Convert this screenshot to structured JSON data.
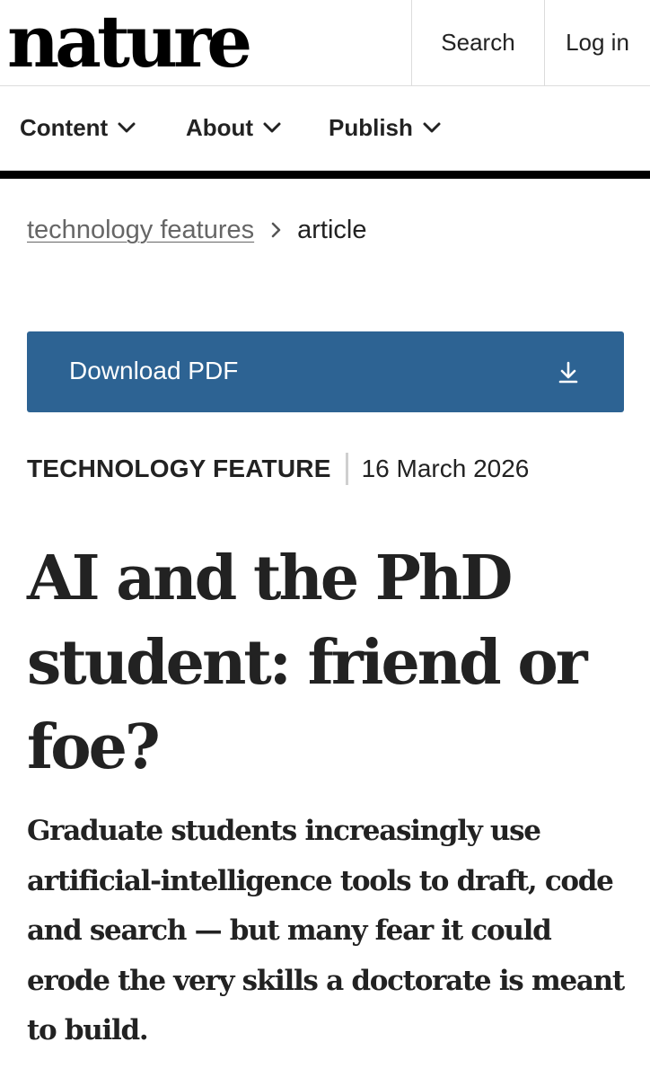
{
  "header": {
    "logo_text": "nature",
    "search_label": "Search",
    "login_label": "Log in"
  },
  "nav": {
    "items": [
      {
        "label": "Content",
        "icon": "chevron-down-icon"
      },
      {
        "label": "About",
        "icon": "chevron-down-icon"
      },
      {
        "label": "Publish",
        "icon": "chevron-down-icon"
      }
    ]
  },
  "breadcrumb": {
    "parent": "technology features",
    "separator_icon": "chevron-right-icon",
    "current": "article"
  },
  "download": {
    "label": "Download PDF",
    "icon": "download-icon"
  },
  "article": {
    "type": "TECHNOLOGY FEATURE",
    "date": "16 March 2026",
    "title": "AI and the PhD student: friend or foe?",
    "standfirst": "Graduate students increasingly use artificial-intelligence tools to draft, code and search — but many fear it could erode the very skills a doctorate is meant to build."
  },
  "colors": {
    "download_button": "#2d6393",
    "text": "#222222",
    "link": "#666666",
    "rule": "#000000"
  }
}
